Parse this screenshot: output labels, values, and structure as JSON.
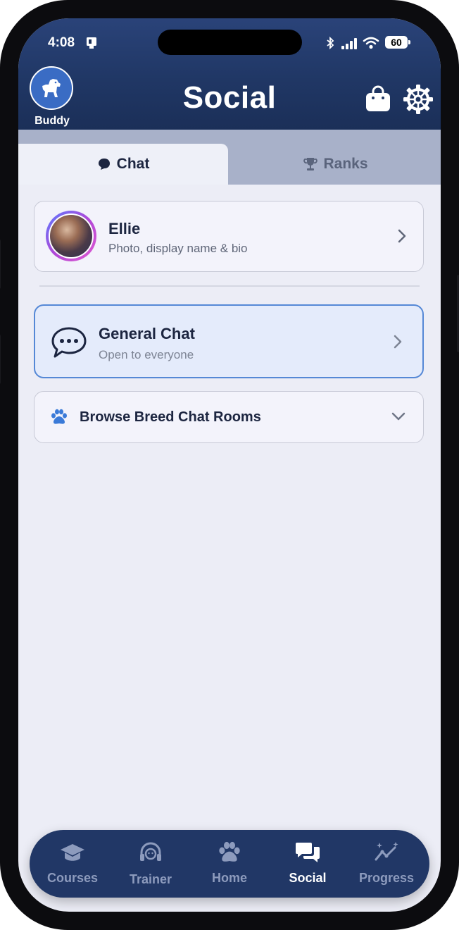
{
  "status_bar": {
    "time": "4:08",
    "battery": "60"
  },
  "header": {
    "title": "Social",
    "pet_name": "Buddy"
  },
  "tabs": [
    {
      "label": "Chat",
      "icon": "chat-bubble-icon",
      "active": true
    },
    {
      "label": "Ranks",
      "icon": "trophy-icon",
      "active": false
    }
  ],
  "profile": {
    "name": "Ellie",
    "subtitle": "Photo, display name & bio"
  },
  "general_chat": {
    "title": "General Chat",
    "subtitle": "Open to everyone"
  },
  "breed_rooms": {
    "label": "Browse Breed Chat Rooms"
  },
  "bottom_nav": [
    {
      "label": "Courses",
      "icon": "graduation-cap-icon",
      "active": false
    },
    {
      "label": "Trainer",
      "icon": "trainer-headset-icon",
      "active": false
    },
    {
      "label": "Home",
      "icon": "paw-icon",
      "active": false
    },
    {
      "label": "Social",
      "icon": "chat-bubbles-icon",
      "active": true
    },
    {
      "label": "Progress",
      "icon": "trend-sparkle-icon",
      "active": false
    }
  ],
  "colors": {
    "header_bg": "#203765",
    "accent_blue": "#5588d6",
    "nav_bg": "#213766",
    "screen_bg": "#ecedf6"
  }
}
